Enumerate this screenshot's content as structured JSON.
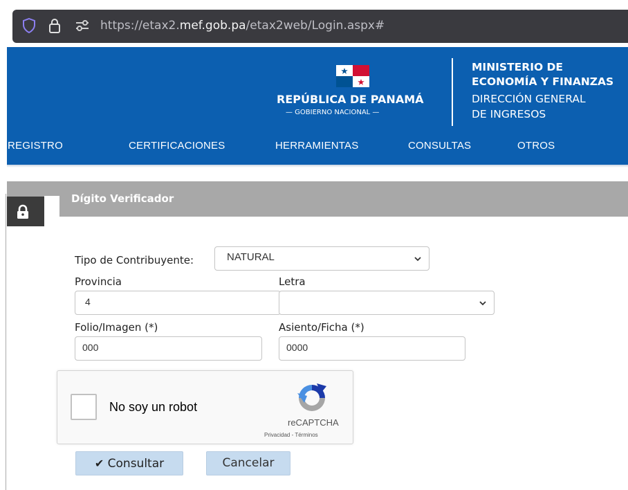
{
  "browser": {
    "url_prefix": "https://etax2.",
    "url_domain": "mef.gob.pa",
    "url_path": "/etax2web/Login.aspx#"
  },
  "header": {
    "republic": "REPÚBLICA DE PANAMÁ",
    "government": "— GOBIERNO NACIONAL —",
    "ministry_line1": "MINISTERIO DE",
    "ministry_line2": "ECONOMÍA Y FINANZAS",
    "direction_line1": "DIRECCIÓN GENERAL",
    "direction_line2": "DE INGRESOS",
    "bg_color": "#0c5fb0"
  },
  "nav": [
    "REGISTRO",
    "CERTIFICACIONES",
    "HERRAMIENTAS",
    "CONSULTAS",
    "OTROS"
  ],
  "panel": {
    "title": "Dígito Verificador"
  },
  "form": {
    "tipo_label": "Tipo de Contribuyente:",
    "tipo_value": "NATURAL",
    "provincia_label": "Provincia",
    "provincia_value": "4",
    "letra_label": "Letra",
    "letra_value": "",
    "folio_label": "Folio/Imagen (*)",
    "folio_value": "000",
    "asiento_label": "Asiento/Ficha (*)",
    "asiento_value": "0000"
  },
  "recaptcha": {
    "label": "No soy un robot",
    "brand": "reCAPTCHA",
    "links": "Privacidad - Términos"
  },
  "buttons": {
    "consultar_icon": "✔",
    "consultar": "Consultar",
    "cancelar": "Cancelar"
  }
}
